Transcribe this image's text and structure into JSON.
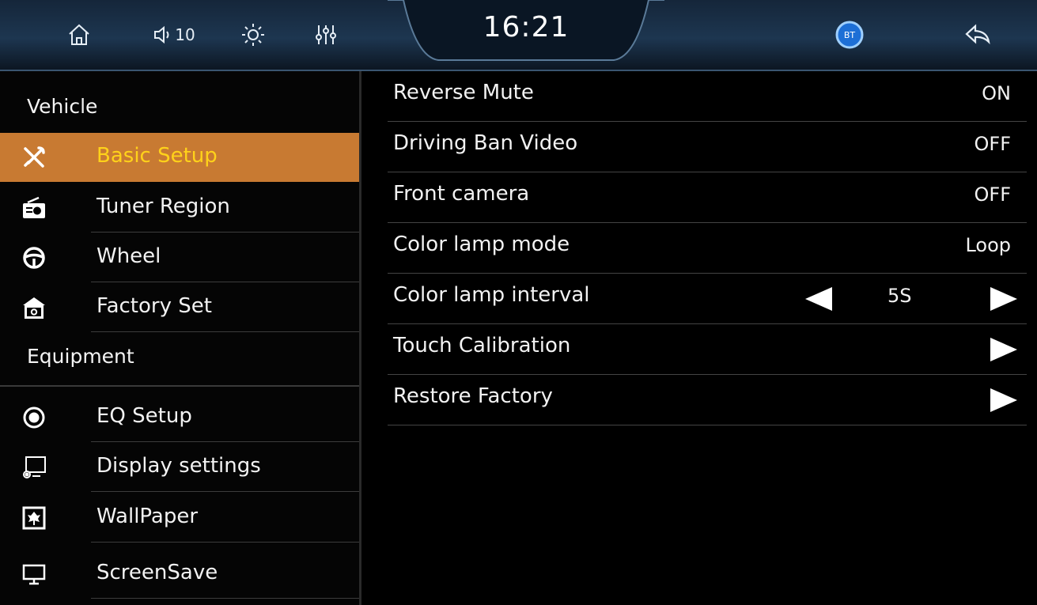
{
  "statusbar": {
    "clock": "16:21",
    "volume_level": "10",
    "bt_label": "BT",
    "icons": [
      "home-icon",
      "volume-icon",
      "brightness-icon",
      "equalizer-icon",
      "bluetooth-icon",
      "back-icon"
    ]
  },
  "sidebar": {
    "vehicle_header": "Vehicle",
    "equipment_header": "Equipment",
    "vehicle_items": [
      {
        "label": "Basic Setup",
        "icon": "tools-icon",
        "active": true
      },
      {
        "label": "Tuner Region",
        "icon": "radio-icon"
      },
      {
        "label": "Wheel",
        "icon": "steering-wheel-icon"
      },
      {
        "label": "Factory Set",
        "icon": "factory-icon"
      }
    ],
    "equipment_items": [
      {
        "label": "EQ Setup",
        "icon": "speaker-icon"
      },
      {
        "label": "Display settings",
        "icon": "display-settings-icon"
      },
      {
        "label": "WallPaper",
        "icon": "wallpaper-icon"
      },
      {
        "label": "ScreenSave",
        "icon": "monitor-icon"
      }
    ]
  },
  "settings": [
    {
      "label": "Reverse Mute",
      "value": "ON"
    },
    {
      "label": "Driving Ban Video",
      "value": "OFF"
    },
    {
      "label": "Front camera",
      "value": "OFF"
    },
    {
      "label": "Color lamp mode",
      "value": "Loop"
    },
    {
      "label": "Color lamp interval",
      "value": "5S"
    },
    {
      "label": "Touch Calibration",
      "value": ""
    },
    {
      "label": "Restore Factory",
      "value": ""
    }
  ],
  "colors": {
    "active_bg": "#c87a32",
    "active_text": "#ffd21a",
    "topbar": "#1d3650"
  }
}
